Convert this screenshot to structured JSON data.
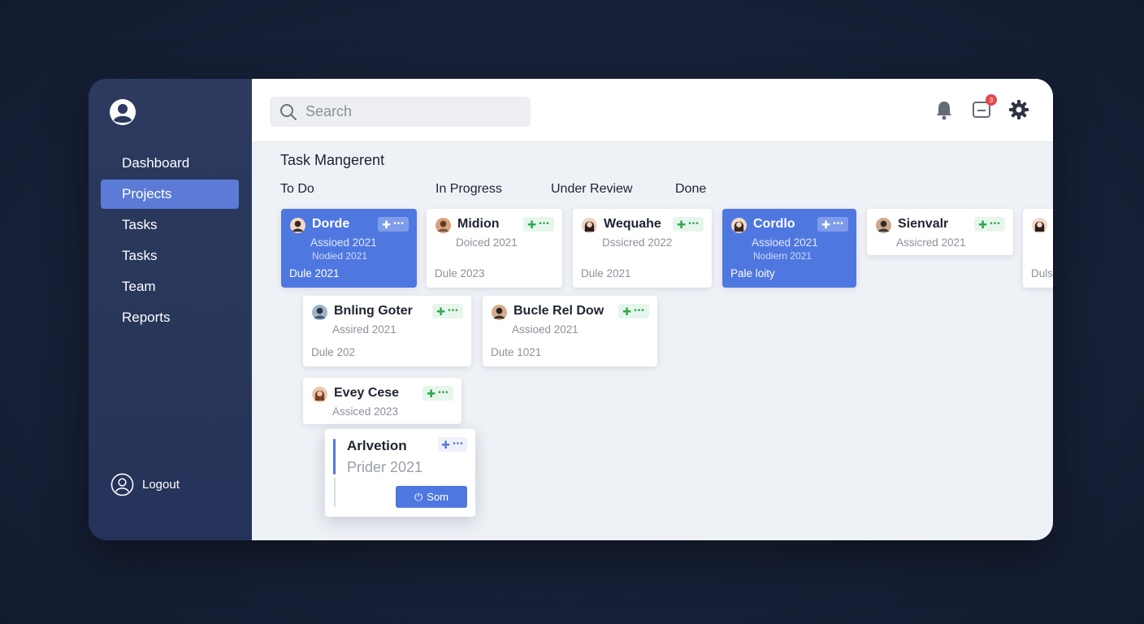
{
  "sidebar": {
    "nav": [
      "Dashboard",
      "Projects",
      "Tasks",
      "Tasks",
      "Team",
      "Reports"
    ],
    "active_index": 1,
    "logout_label": "Logout"
  },
  "topbar": {
    "search_placeholder": "Search",
    "notification_count": "3"
  },
  "board": {
    "title": "Task Mangerent",
    "columns": [
      "To Do",
      "In Progress",
      "Under Review",
      "Done"
    ],
    "cards": [
      {
        "title": "Dorde",
        "sub": "Assioed 2021",
        "sub2": "Nodied 2021",
        "due": "Dule 2021",
        "highlight": true
      },
      {
        "title": "Midion",
        "sub": "Doiced 2021",
        "due": "Dule 2023"
      },
      {
        "title": "Wequahe",
        "sub": "Dssicred 2022",
        "due": "Dule 2021"
      },
      {
        "title": "Cordlo",
        "sub": "Assioed 2021",
        "sub2": "Nodiern 2021",
        "due": "Pale loity",
        "highlight": true
      },
      {
        "title": "Sienvalr",
        "sub": "Assicred 2021",
        "due": ""
      },
      {
        "title": "",
        "sub": "",
        "due": "Duls"
      },
      {
        "title": "Bnling Goter",
        "sub": "Assired 2021",
        "due": "Dule 202"
      },
      {
        "title": "Bucle Rel Dow",
        "sub": "Assioed 2021",
        "due": "Dute 1021"
      },
      {
        "title": "Evey Cese",
        "sub": "Assiced 2023",
        "due": ""
      }
    ],
    "popup": {
      "title": "Arlvetion",
      "sub": "Prider 2021",
      "button_label": "Som"
    }
  },
  "colors": {
    "accent": "#4f77e0",
    "sidebar_bg": "#2a385d",
    "tag_green": "#2fa84f",
    "badge_red": "#e5484d"
  },
  "icons": [
    "user-avatar-icon",
    "search-icon",
    "bell-icon",
    "inbox-icon",
    "gear-icon",
    "logout-user-icon",
    "plus-icon",
    "more-dots-icon",
    "power-icon"
  ]
}
